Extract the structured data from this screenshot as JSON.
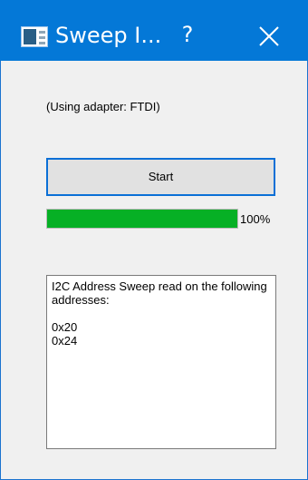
{
  "window": {
    "title": "Sweep I...",
    "help_glyph": "?",
    "close_icon": "close-icon",
    "accent_color": "#0478d7"
  },
  "main": {
    "adapter_text": "(Using adapter: FTDI)",
    "start_label": "Start",
    "progress": {
      "percent": 100,
      "label": "100%",
      "fill_color": "#06b025"
    },
    "output_text": "I2C Address Sweep read on the following addresses:\n\n0x20\n0x24"
  }
}
